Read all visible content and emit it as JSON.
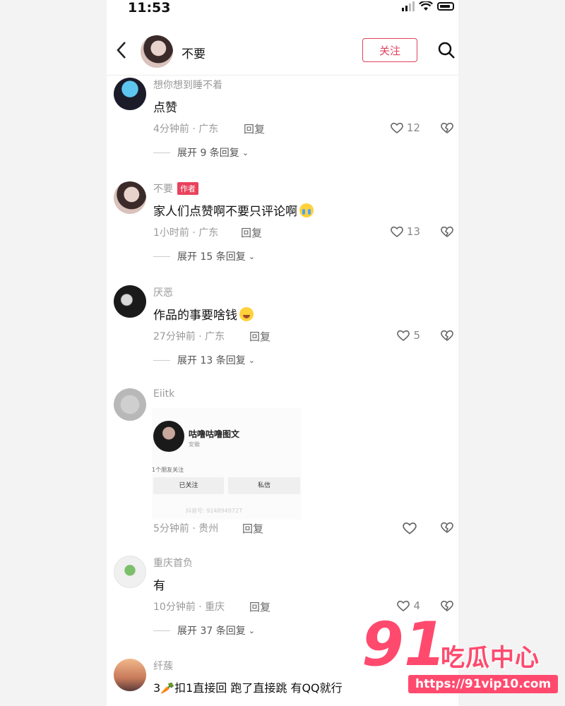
{
  "status_bar": {
    "time": "11:53"
  },
  "header": {
    "back_icon": "chevron-left-icon",
    "username": "不要",
    "follow_label": "关注",
    "search_icon": "search-icon"
  },
  "comments": [
    {
      "name": "想你想到睡不着",
      "text": "点赞",
      "meta": "4分钟前 · 广东",
      "reply": "回复",
      "likes": "12",
      "expand": "展开 9 条回复"
    },
    {
      "name": "不要",
      "tag": "作者",
      "text": "家人们点赞啊不要只评论啊",
      "emoji": "crying-face-emoji",
      "meta": "1小时前 · 广东",
      "reply": "回复",
      "likes": "13",
      "expand": "展开 15 条回复"
    },
    {
      "name": "厌恶",
      "text": "作品的事要啥钱",
      "emoji": "rolling-laughing-emoji",
      "meta": "27分钟前 · 广东",
      "reply": "回复",
      "likes": "5",
      "expand": "展开 13 条回复"
    },
    {
      "name": "Eiitk",
      "meta": "5分钟前 · 贵州",
      "reply": "回复",
      "likes": "",
      "image": {
        "name": "咕噜咕噜图文",
        "sub": "安徽",
        "friends": "1个朋友关注",
        "btn1": "已关注",
        "btn2": "私信",
        "id": "抖音号: 9248949727"
      }
    },
    {
      "name": "重庆首负",
      "text": "有",
      "meta": "10分钟前 · 重庆",
      "reply": "回复",
      "likes": "4",
      "expand": "展开 37 条回复"
    },
    {
      "name": "纤蔟",
      "text": "3🥕扣1直接回  跑了直接跳 有QQ就行"
    }
  ],
  "watermark": {
    "number": "91",
    "title": "吃瓜中心",
    "url": "https://91vip10.com"
  },
  "colors": {
    "accent": "#e0425e",
    "watermark": "#ff4a6e"
  }
}
